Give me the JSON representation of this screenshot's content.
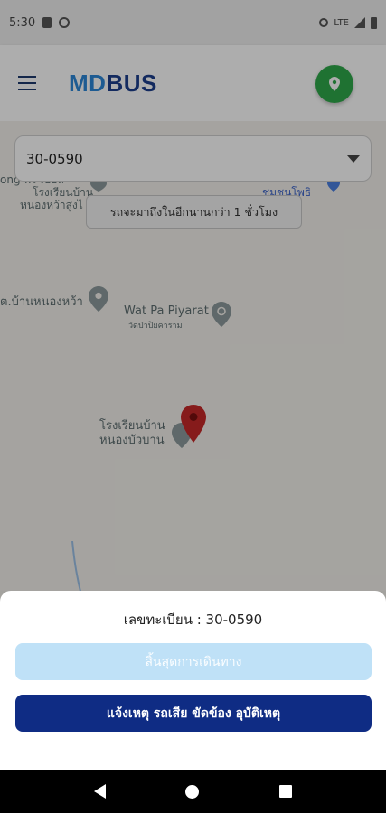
{
  "status_bar": {
    "time": "5:30",
    "network": "LTE",
    "icons": [
      "sim-icon",
      "data-saver-icon",
      "location-icon",
      "signal-icon",
      "battery-icon"
    ]
  },
  "app_bar": {
    "logo_md": "MD",
    "logo_bus": "BUS",
    "menu_icon": "hamburger-menu-icon",
    "location_icon": "map-pin-icon",
    "fab_color": "#2fa84a"
  },
  "bus_selector": {
    "value": "30-0590",
    "arrow_icon": "dropdown-arrow-icon"
  },
  "toast": {
    "text": "รถจะมาถึงในอีกนานกว่า 1 ชั่วโมง"
  },
  "map": {
    "labels": {
      "school_top_1": "ong พร เบอล",
      "school_top_2": "โรงเรียนบ้าน",
      "school_top_3": "หนองหว้าสูงไ",
      "top_right": "ชุมชนโพธิ",
      "village": "ต.บ้านหนองหว้า",
      "temple": "Wat Pa Piyarat",
      "temple_thai": "วัดป่าปิยคาราม",
      "school_1": "โรงเรียนบ้าน",
      "school_2": "หนองบัวบาน"
    },
    "marker_color": "#c62828"
  },
  "sheet": {
    "plate_label": "เลขทะเบียน : 30-0590",
    "end_trip_button": "สิ้นสุดการเดินทาง",
    "report_button": "แจ้งเหตุ รถเสีย ขัดข้อง อุบัติเหตุ"
  },
  "colors": {
    "primary": "#0f2c84",
    "accent": "#2b86d8",
    "disabled": "#bfe1f7"
  }
}
